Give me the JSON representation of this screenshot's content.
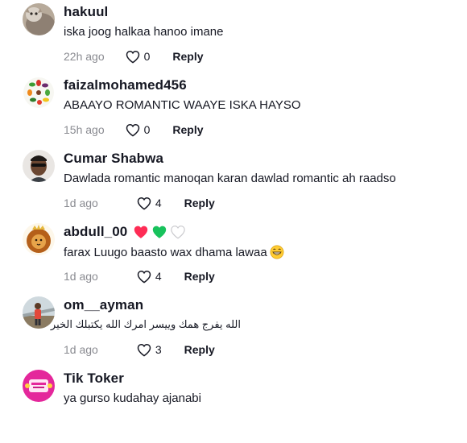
{
  "comments": [
    {
      "username": "hakuul",
      "text": "iska joog halkaa hanoo imane",
      "time": "22h ago",
      "likes": "0",
      "reply_label": "Reply",
      "avatar_icon": "cat-avatar"
    },
    {
      "username": "faizalmohamed456",
      "text": "ABAAYO ROMANTIC WAAYE ISKA HAYSO",
      "time": "15h ago",
      "likes": "0",
      "reply_label": "Reply",
      "avatar_icon": "vegetables-avatar"
    },
    {
      "username": "Cumar Shabwa",
      "text": "Dawlada romantic manoqan karan dawlad romantic ah raadso",
      "time": "1d ago",
      "likes": "4",
      "reply_label": "Reply",
      "avatar_icon": "man-sunglasses-avatar"
    },
    {
      "username": "abdull_00",
      "text": "farax Luugo baasto wax dhama lawaa",
      "time": "1d ago",
      "likes": "4",
      "reply_label": "Reply",
      "avatar_icon": "lion-avatar",
      "name_hearts": [
        "red-heart-icon",
        "green-heart-icon",
        "white-heart-icon"
      ],
      "text_emoji": "grinning-face-icon"
    },
    {
      "username": "om__ayman",
      "text": "الله يفرج همك وييسر امرك الله يكتبلك الخير",
      "time": "1d ago",
      "likes": "3",
      "reply_label": "Reply",
      "avatar_icon": "person-outdoors-avatar"
    },
    {
      "username": "Tik Toker",
      "text": "ya gurso kudahay ajanabi",
      "time": "",
      "likes": "",
      "reply_label": "",
      "avatar_icon": "pink-logo-avatar"
    }
  ],
  "colors": {
    "text": "#161823",
    "secondary": "#8a8b91",
    "heart_red": "#fe2c55",
    "heart_green": "#18c25c"
  }
}
